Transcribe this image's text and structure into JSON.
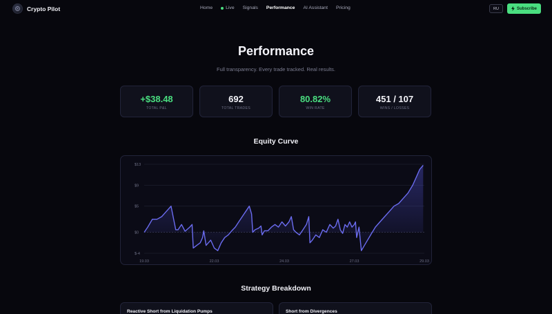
{
  "nav": {
    "brand": "Crypto Pilot",
    "items": [
      {
        "label": "Home",
        "active": false
      },
      {
        "label": "Live",
        "active": false,
        "dot": true
      },
      {
        "label": "Signals",
        "active": false
      },
      {
        "label": "Performance",
        "active": true
      },
      {
        "label": "AI Assistant",
        "active": false
      },
      {
        "label": "Pricing",
        "active": false
      }
    ],
    "lang": "RU",
    "subscribe": "Subscribe"
  },
  "hero": {
    "title": "Performance",
    "subtitle": "Full transparency. Every trade tracked. Real results."
  },
  "stats": [
    {
      "value": "+$38.48",
      "label": "TOTAL P&L",
      "color": "#4ade80"
    },
    {
      "value": "692",
      "label": "TOTAL TRADES",
      "color": "#f3f3f8"
    },
    {
      "value": "80.82%",
      "label": "WIN RATE",
      "color": "#4ade80"
    },
    {
      "value": "451 / 107",
      "label": "WINS / LOSSES",
      "color": "#f3f3f8"
    }
  ],
  "equity": {
    "title": "Equity Curve",
    "chart_data": {
      "type": "area",
      "title": "Equity Curve",
      "xlabel": "",
      "ylabel": "",
      "y_ticks": [
        13,
        9,
        5,
        0,
        -4
      ],
      "y_tick_labels": [
        "$13",
        "$9",
        "$5",
        "$0",
        "$-4"
      ],
      "x_ticks": [
        0,
        3,
        6,
        9,
        12
      ],
      "x_tick_labels": [
        "19.03",
        "22.03",
        "24.03",
        "27.03",
        "29.03"
      ],
      "xlim": [
        0,
        12
      ],
      "ylim": [
        -4,
        13
      ],
      "grid": true,
      "baseline": 0,
      "line_color": "#6b6cf0",
      "x": [
        0,
        0.15,
        0.35,
        0.55,
        0.75,
        0.95,
        1.15,
        1.35,
        1.45,
        1.6,
        1.75,
        1.95,
        2.05,
        2.1,
        2.25,
        2.4,
        2.5,
        2.55,
        2.65,
        2.75,
        2.85,
        3.0,
        3.15,
        3.3,
        3.45,
        3.6,
        3.75,
        3.9,
        4.05,
        4.2,
        4.35,
        4.5,
        4.6,
        4.65,
        4.75,
        4.9,
        5.0,
        5.05,
        5.15,
        5.3,
        5.45,
        5.6,
        5.75,
        5.9,
        6.05,
        6.2,
        6.3,
        6.4,
        6.5,
        6.65,
        6.8,
        6.95,
        7.05,
        7.1,
        7.2,
        7.35,
        7.5,
        7.65,
        7.8,
        7.95,
        8.1,
        8.2,
        8.3,
        8.4,
        8.5,
        8.6,
        8.7,
        8.8,
        8.9,
        9.0,
        9.05,
        9.1,
        9.2,
        9.3,
        9.5,
        9.7,
        9.9,
        10.1,
        10.3,
        10.5,
        10.7,
        10.9,
        11.1,
        11.3,
        11.5,
        11.65,
        11.8,
        11.95
      ],
      "y": [
        0,
        1,
        2.5,
        2.5,
        3.0,
        4.0,
        5.0,
        0.5,
        0.5,
        1.5,
        0.2,
        1.0,
        1.5,
        -3.0,
        -2.5,
        -2.0,
        -1.0,
        0.3,
        -2.5,
        -2.0,
        -1.5,
        -3.0,
        -3.5,
        -2.0,
        -1.0,
        -0.5,
        0.3,
        1.0,
        2.0,
        3.0,
        4.0,
        5.0,
        3.5,
        0.0,
        0.5,
        0.8,
        1.2,
        -0.5,
        0.3,
        0.3,
        1.0,
        1.5,
        1.0,
        2.0,
        1.2,
        2.0,
        3.0,
        0.5,
        0.0,
        -0.5,
        0.5,
        1.5,
        3.0,
        -2.0,
        -1.5,
        -0.5,
        -1.0,
        0.5,
        0.0,
        1.5,
        0.8,
        1.2,
        2.5,
        0.5,
        -0.2,
        1.5,
        1.0,
        2.0,
        1.0,
        1.5,
        2.0,
        -1.0,
        1.0,
        -3.5,
        -2.0,
        -0.5,
        1.0,
        2.0,
        3.0,
        4.0,
        5.0,
        5.5,
        6.5,
        7.5,
        9.0,
        10.5,
        12.0,
        12.8
      ]
    }
  },
  "strategies": {
    "title": "Strategy Breakdown",
    "items": [
      {
        "name": "Reactive Short from Liquidation Pumps"
      },
      {
        "name": "Short from Divergences"
      }
    ]
  }
}
